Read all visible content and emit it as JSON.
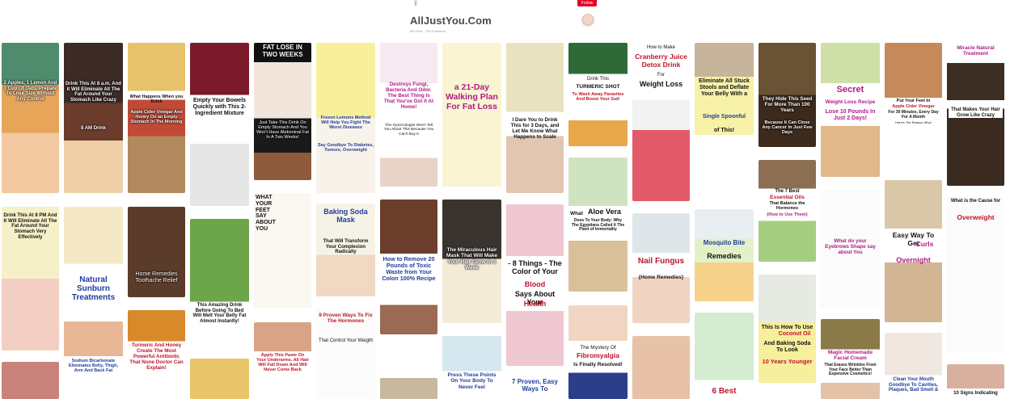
{
  "header": {
    "title": "AllJustYou.Com",
    "stats": "800 Pins · 700 Followers",
    "follow_label": "Follow",
    "share_icon": "share-icon"
  },
  "pins": {
    "c1_1": "2 Apples, 1 Lemon And 1 Cup Of Oats. Prepare To Lose Size Without Any Control",
    "c1_2": "Drink This At 8 PM And It Will Eliminate All The Fat Around Your Stomach Very Effectively",
    "c2_1": "Drink This At 8 a.m. And it Will Eliminate All The Fat Around Your Stomach Like Crazy",
    "c2_1b": "8 AM Drink",
    "c2_2": "Natural Sunburn Treatments",
    "c2_3": "Sodium Bicarbonate Eliminates Belly, Thigh, Arm And Back Fat",
    "c3_1a": "What Happens When you Drink",
    "c3_1b": "Apple Cider Vinegar And Honey On an Empty Stomach In The Morning",
    "c3_2": "Home Remedies Toothache Relief",
    "c3_3": "Turmeric And Honey Create The Most Powerful Antibiotic That None Doctor Can Explain!",
    "c4_1": "Empty Your Bowels Quickly with This 2-Ingredient Mixture",
    "c4_2": "This Amazing Drink Before Going To Bed Will Melt Your Belly Fat Almost Instantly!",
    "c5_1a": "FAT LOSE IN TWO WEEKS",
    "c5_1b": "Just Take This Drink On Empty Stomach And You Won't Have Abdominal Fat In A Two Weeks!",
    "c5_2": "WHAT YOUR FEET SAY ABOUT YOU",
    "c5_3": "Apply This Paste On Your Underarms. All Hair Will Fall Down And Will Never Come Back",
    "c6_1": "Frozen Lemons Method Will Help You Fight The Worst Diseases",
    "c6_1b": "Say Goodbye To Diabetes, Tumors, Overweight",
    "c6_2": "Baking Soda Mask",
    "c6_2b": "That Will Transform Your Complexion Radically",
    "c6_3": "9 Proven Ways To Fix The Hormones",
    "c6_3b": "That Control Your Weight",
    "c7_1": "Destroys Fungi, Bacteria And Odor. The Best Thing Is That You've Got It At Home!",
    "c7_1b": "The Gynecologist Won't Tell You About This Because You Can't Buy It",
    "c7_2": "How to Remove 20 Pounds of Toxic Waste from Your Colon 100% Recipe",
    "c8_1": "a 21-Day Walking Plan For Fat Loss",
    "c8_2": "The Miraculous Hair Mask That Will Make Your Hair Grow In 1 Week",
    "c8_3": "Press These Points On Your Body To Never Feel",
    "c9_1": "I Dare You to Drink This for 3 Days, and Let Me Know What Happens to Scale",
    "c9_2a": "- 8 Things - The Color of Your",
    "c9_2b": "Blood",
    "c9_2c": "Says About Your",
    "c9_2d": "Health",
    "c9_3": "7 Proven, Easy Ways To",
    "c10_1a": "Drink This",
    "c10_1b": "TURMERIC SHOT",
    "c10_1c": "To Wash Away Parasites And Boost Your Gut!",
    "c10_2a": "What",
    "c10_2b": "Aloe Vera",
    "c10_2c": "Does To Your Body: Why The Egyptians Called It The Plant of Immortality",
    "c10_3a": "The Mystery Of",
    "c10_3b": "Fibromyalgia",
    "c10_3c": "Is Finally Resolved!",
    "c11_1a": "How to Make",
    "c11_1b": "Cranberry Juice Detox Drink",
    "c11_1c": "For",
    "c11_1d": "Weight Loss",
    "c11_2a": "Nail Fungus",
    "c11_2b": "{Home Remedies}",
    "c12_1a": "Eliminate All Stuck Stools and Deflate Your Belly With a",
    "c12_1b": "Single Spoonful",
    "c12_1c": "of This!",
    "c12_2a": "Mosquito Bite",
    "c12_2b": "Remedies",
    "c12_3": "6 Best",
    "c13_1": "They Hide This Seed For More Than 100 Years",
    "c13_1b": "Because It Can Close Any Cancer In Just Few Days",
    "c13_2a": "The 7 Best",
    "c13_2b": "Essential Oils",
    "c13_2c": "That Balance the Hormones",
    "c13_2d": "{How to Use Them}",
    "c13_3a": "This Is How To Use",
    "c13_3b": "Coconut Oil",
    "c13_3c": "And Baking Soda To Look",
    "c13_3d": "10 Years Younger",
    "c14_1a": "Secret",
    "c14_1b": "Weight Loss Recipe",
    "c14_1c": "Lose 10 Pounds In Just 2 Days!",
    "c14_2": "What do your Eyebrows Shape say about You",
    "c14_3a": "Magic Homemade Facial Cream",
    "c14_3b": "That Erases Wrinkles From Your Face Better Than Expensive Cosmetics!",
    "c15_1a": "Put Your Feet In",
    "c15_1b": "Apple Cider Vinegar",
    "c15_1c": "For 30 Minutes, Every Day For A Month",
    "c15_1d": "Here's The Reason Why!",
    "c15_2a": "Easy Way To Get",
    "c15_2b": "Curls",
    "c15_2c": "Overnight",
    "c15_3": "Clean Your Mouth Goodbye To Cavities, Plaques, Bad Smell &",
    "c16_1a": "Miracle Natural Treatment",
    "c16_1b": "That Makes Your Hair Grow Like Crazy",
    "c16_2a": "What is the Cause for",
    "c16_2b": "Overweight",
    "c16_3": "10 Signs Indicating"
  },
  "colors": {
    "brand_red": "#e60023",
    "title_gray": "#4a4a4a"
  }
}
